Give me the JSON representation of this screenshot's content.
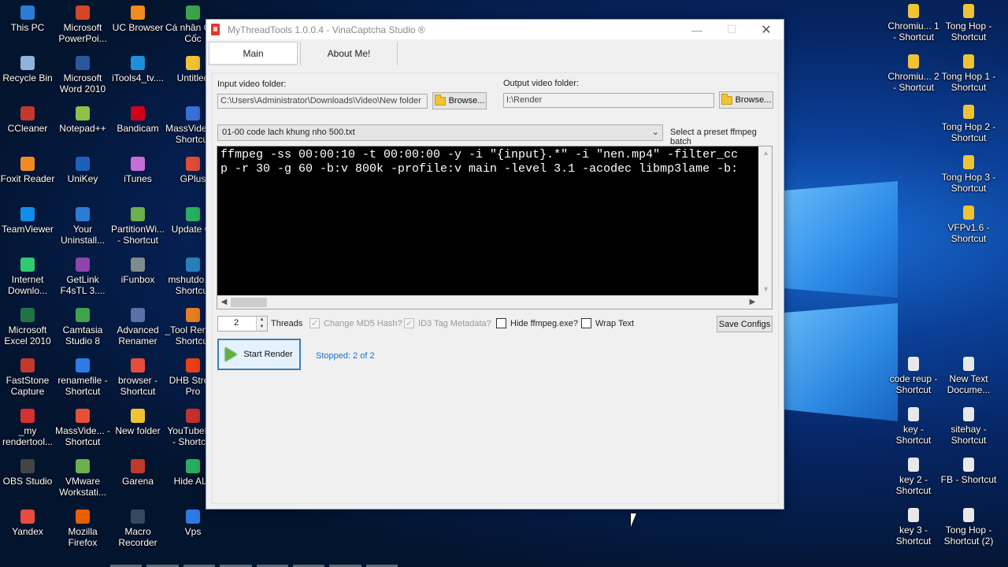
{
  "desktop": {
    "left_icons": [
      {
        "label": "This PC",
        "icon": "computer-icon",
        "color": "#2a7dd4"
      },
      {
        "label": "Microsoft PowerPoi...",
        "icon": "powerpoint-icon",
        "color": "#d24726"
      },
      {
        "label": "UC Browser",
        "icon": "uc-browser-icon",
        "color": "#f28c1b"
      },
      {
        "label": "Cá nhân Cốc Cốc",
        "icon": "coccoc-icon",
        "color": "#3aa34a"
      },
      {
        "label": "Recycle Bin",
        "icon": "recycle-bin-icon",
        "color": "#8fb3d9"
      },
      {
        "label": "Microsoft Word 2010",
        "icon": "word-icon",
        "color": "#2b579a"
      },
      {
        "label": "iTools4_tv....",
        "icon": "itools-icon",
        "color": "#1c8fd8"
      },
      {
        "label": "Untitled",
        "icon": "folder-icon",
        "color": "#f1c232"
      },
      {
        "label": "CCleaner",
        "icon": "ccleaner-icon",
        "color": "#c0392b"
      },
      {
        "label": "Notepad++",
        "icon": "notepad-icon",
        "color": "#8bc34a"
      },
      {
        "label": "Bandicam",
        "icon": "bandicam-icon",
        "color": "#d0021b"
      },
      {
        "label": "MassVide... - Shortcut",
        "icon": "massvideo-icon",
        "color": "#3a6fd8"
      },
      {
        "label": "Foxit Reader",
        "icon": "foxit-icon",
        "color": "#f08a24"
      },
      {
        "label": "UniKey",
        "icon": "unikey-icon",
        "color": "#1d5fb8"
      },
      {
        "label": "iTunes",
        "icon": "itunes-icon",
        "color": "#c86dd7"
      },
      {
        "label": "GPlus",
        "icon": "gplus-icon",
        "color": "#dd4b39"
      },
      {
        "label": "TeamViewer",
        "icon": "teamviewer-icon",
        "color": "#0e8ee9"
      },
      {
        "label": "Your Uninstall...",
        "icon": "uninstaller-icon",
        "color": "#2a7dd4"
      },
      {
        "label": "PartitionWi... - Shortcut",
        "icon": "partition-icon",
        "color": "#6ab04c"
      },
      {
        "label": "Update GI",
        "icon": "update-icon",
        "color": "#27ae60"
      },
      {
        "label": "Internet Downlo...",
        "icon": "idm-icon",
        "color": "#2ecc71"
      },
      {
        "label": "GetLink F4sTL 3....",
        "icon": "getlink-icon",
        "color": "#8e44ad"
      },
      {
        "label": "iFunbox",
        "icon": "ifunbox-icon",
        "color": "#7f8c8d"
      },
      {
        "label": "mshutdo... - Shortcut",
        "icon": "shutdown-icon",
        "color": "#2980b9"
      },
      {
        "label": "Microsoft Excel 2010",
        "icon": "excel-icon",
        "color": "#217346"
      },
      {
        "label": "Camtasia Studio 8",
        "icon": "camtasia-icon",
        "color": "#3fa34d"
      },
      {
        "label": "Advanced Renamer",
        "icon": "renamer-icon",
        "color": "#5b6fa8"
      },
      {
        "label": "_Tool Ren... - Shortcut",
        "icon": "tool-icon",
        "color": "#e67e22"
      },
      {
        "label": "FastStone Capture",
        "icon": "faststone-icon",
        "color": "#c0392b"
      },
      {
        "label": "renamefile - Shortcut",
        "icon": "renamefile-icon",
        "color": "#2c7be5"
      },
      {
        "label": "browser - Shortcut",
        "icon": "browser-icon",
        "color": "#e74c3c"
      },
      {
        "label": "DHB Stre... Pro",
        "icon": "dhb-icon",
        "color": "#e84118"
      },
      {
        "label": "_my rendertool...",
        "icon": "rendertool-icon",
        "color": "#d63031"
      },
      {
        "label": "MassVide... - Shortcut",
        "icon": "massvideo2-icon",
        "color": "#e55039"
      },
      {
        "label": "New folder",
        "icon": "folder-icon",
        "color": "#f1c232"
      },
      {
        "label": "YouTubeB... - Shortc...",
        "icon": "youtube-icon",
        "color": "#c4302b"
      },
      {
        "label": "OBS Studio",
        "icon": "obs-icon",
        "color": "#444444"
      },
      {
        "label": "VMware Workstati...",
        "icon": "vmware-icon",
        "color": "#6ab04c"
      },
      {
        "label": "Garena",
        "icon": "garena-icon",
        "color": "#c0392b"
      },
      {
        "label": "Hide ALL",
        "icon": "hide-icon",
        "color": "#27ae60"
      },
      {
        "label": "Yandex",
        "icon": "yandex-icon",
        "color": "#e74c3c"
      },
      {
        "label": "Mozilla Firefox",
        "icon": "firefox-icon",
        "color": "#e66000"
      },
      {
        "label": "Macro Recorder",
        "icon": "macro-icon",
        "color": "#34495e"
      },
      {
        "label": "Vps",
        "icon": "vps-icon",
        "color": "#2c7be5"
      }
    ],
    "right_icons": [
      {
        "label": "Chromiu... 1 - Shortcut",
        "icon": "folder-icon",
        "color": "#f1c232"
      },
      {
        "label": "Tong Hop - Shortcut",
        "icon": "folder-icon",
        "color": "#f1c232"
      },
      {
        "label": "Chromiu... 2 - Shortcut",
        "icon": "folder-icon",
        "color": "#f1c232"
      },
      {
        "label": "Tong Hop 1 - Shortcut",
        "icon": "folder-icon",
        "color": "#f1c232"
      },
      {
        "label": "Tong Hop 2 - Shortcut",
        "icon": "folder-icon",
        "color": "#f1c232"
      },
      {
        "label": "Tong Hop 3 - Shortcut",
        "icon": "folder-icon",
        "color": "#f1c232"
      },
      {
        "label": "VFPv1.6 - Shortcut",
        "icon": "folder-icon",
        "color": "#f1c232"
      },
      {
        "label": "code reup - Shortcut",
        "icon": "text-file-icon",
        "color": "#e8e8e8"
      },
      {
        "label": "New Text Docume...",
        "icon": "text-file-icon",
        "color": "#e8e8e8"
      },
      {
        "label": "key - Shortcut",
        "icon": "text-file-icon",
        "color": "#e8e8e8"
      },
      {
        "label": "sitehay - Shortcut",
        "icon": "text-file-icon",
        "color": "#e8e8e8"
      },
      {
        "label": "key 2 - Shortcut",
        "icon": "text-file-icon",
        "color": "#e8e8e8"
      },
      {
        "label": "FB - Shortcut",
        "icon": "text-file-icon",
        "color": "#e8e8e8"
      },
      {
        "label": "key 3 - Shortcut",
        "icon": "text-file-icon",
        "color": "#e8e8e8"
      },
      {
        "label": "Tong Hop - Shortcut (2)",
        "icon": "text-file-icon",
        "color": "#e8e8e8"
      }
    ]
  },
  "window": {
    "title": "MyThreadTools 1.0.0.4 - VinaCaptcha Studio ®",
    "minimize": "—",
    "maximize": "☐",
    "close": "✕",
    "tabs": [
      {
        "label": "Main"
      },
      {
        "label": "About Me!"
      }
    ],
    "input_folder": {
      "label": "Input video folder:",
      "value": "C:\\Users\\Administrator\\Downloads\\Video\\New folder",
      "browse": "Browse..."
    },
    "output_folder": {
      "label": "Output video folder:",
      "value": "I:\\Render",
      "browse": "Browse..."
    },
    "preset": {
      "selected": "01-00 code lach khung nho 500.txt",
      "label": "Select a preset ffmpeg batch"
    },
    "console": {
      "line1": "ffmpeg -ss 00:00:10 -t 00:00:00 -y -i \"{input}.*\" -i \"nen.mp4\" -filter_cc",
      "line2": "p -r 30 -g 60 -b:v 800k -profile:v main -level 3.1 -acodec libmp3lame -b:"
    },
    "threads": {
      "value": "2",
      "label": "Threads"
    },
    "options": [
      {
        "label": "Change MD5 Hash?",
        "checked": true,
        "disabled": true
      },
      {
        "label": "ID3 Tag Metadata?",
        "checked": true,
        "disabled": true
      },
      {
        "label": "Hide ffmpeg.exe?",
        "checked": false,
        "disabled": false
      },
      {
        "label": "Wrap Text",
        "checked": false,
        "disabled": false
      }
    ],
    "save_configs": "Save Configs",
    "start_render": "Start Render",
    "status": "Stopped: 2 of 2"
  }
}
